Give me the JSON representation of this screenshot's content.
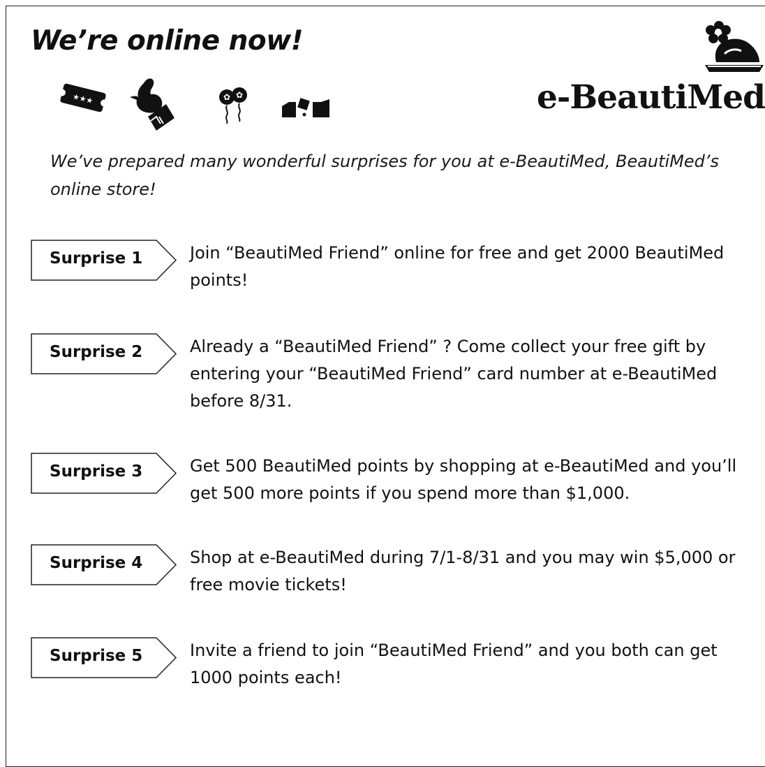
{
  "header": {
    "headline": "We’re online now!",
    "logo_text": "e-BeautiMed"
  },
  "icons": [
    "ticket-icon",
    "bird-on-gift-icon",
    "balloons-icon",
    "gift-boxes-icon"
  ],
  "logo_icon": "flower-on-tray-icon",
  "intro": "We’ve prepared many wonderful surprises for you at e-BeautiMed, BeautiMed’s online store!",
  "surprises": [
    {
      "label": "Surprise 1",
      "text": "Join “BeautiMed Friend” online for free and get 2000 BeautiMed points!"
    },
    {
      "label": "Surprise 2",
      "text": "Already a “BeautiMed Friend” ? Come collect your free gift by entering your “BeautiMed Friend” card number at e-BeautiMed before 8/31."
    },
    {
      "label": "Surprise 3",
      "text": "Get 500 BeautiMed points by shopping at e-BeautiMed and you’ll get 500 more points if you spend more than $1,000."
    },
    {
      "label": "Surprise 4",
      "text": "Shop at e-BeautiMed during 7/1-8/31 and you may win $5,000 or free movie tickets!"
    },
    {
      "label": "Surprise 5",
      "text": "Invite a friend to join “BeautiMed Friend” and you both can get 1000 points each!"
    }
  ]
}
